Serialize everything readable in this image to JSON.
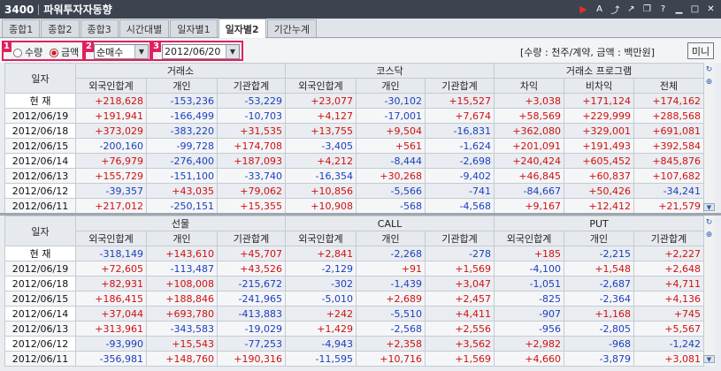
{
  "window": {
    "code": "3400",
    "title": "파워투자자동향"
  },
  "tabs": [
    "종합1",
    "종합2",
    "종합3",
    "시간대별",
    "일자별1",
    "일자별2",
    "기간누계"
  ],
  "active_tab": 5,
  "controls": {
    "markers": [
      "1",
      "2",
      "3"
    ],
    "radio_qty": "수량",
    "radio_amt": "금액",
    "type_select": "순매수",
    "date_value": "2012/06/20",
    "unit_note": "[수량 : 천주/계약, 금액 : 백만원]",
    "mini_button": "미니"
  },
  "top_table": {
    "date_header": "일자",
    "groups": [
      "거래소",
      "코스닥",
      "거래소 프로그램"
    ],
    "columns": [
      "외국인합계",
      "개인",
      "기관합계",
      "외국인합계",
      "개인",
      "기관합계",
      "차익",
      "비차익",
      "전체"
    ],
    "rows": [
      {
        "date": "현 재",
        "v": [
          "+218,628",
          "-153,236",
          "-53,229",
          "+23,077",
          "-30,102",
          "+15,527",
          "+3,038",
          "+171,124",
          "+174,162"
        ]
      },
      {
        "date": "2012/06/19",
        "v": [
          "+191,941",
          "-166,499",
          "-10,703",
          "+4,127",
          "-17,001",
          "+7,674",
          "+58,569",
          "+229,999",
          "+288,568"
        ]
      },
      {
        "date": "2012/06/18",
        "v": [
          "+373,029",
          "-383,220",
          "+31,535",
          "+13,755",
          "+9,504",
          "-16,831",
          "+362,080",
          "+329,001",
          "+691,081"
        ]
      },
      {
        "date": "2012/06/15",
        "v": [
          "-200,160",
          "-99,728",
          "+174,708",
          "-3,405",
          "+561",
          "-1,624",
          "+201,091",
          "+191,493",
          "+392,584"
        ]
      },
      {
        "date": "2012/06/14",
        "v": [
          "+76,979",
          "-276,400",
          "+187,093",
          "+4,212",
          "-8,444",
          "-2,698",
          "+240,424",
          "+605,452",
          "+845,876"
        ]
      },
      {
        "date": "2012/06/13",
        "v": [
          "+155,729",
          "-151,100",
          "-33,740",
          "-16,354",
          "+30,268",
          "-9,402",
          "+46,845",
          "+60,837",
          "+107,682"
        ]
      },
      {
        "date": "2012/06/12",
        "v": [
          "-39,357",
          "+43,035",
          "+79,062",
          "+10,856",
          "-5,566",
          "-741",
          "-84,667",
          "+50,426",
          "-34,241"
        ]
      },
      {
        "date": "2012/06/11",
        "v": [
          "+217,012",
          "-250,151",
          "+15,355",
          "+10,908",
          "-568",
          "-4,568",
          "+9,167",
          "+12,412",
          "+21,579"
        ]
      }
    ]
  },
  "bottom_table": {
    "date_header": "일자",
    "groups": [
      "선물",
      "CALL",
      "PUT"
    ],
    "columns": [
      "외국인합계",
      "개인",
      "기관합계",
      "외국인합계",
      "개인",
      "기관합계",
      "외국인합계",
      "개인",
      "기관합계"
    ],
    "rows": [
      {
        "date": "현 재",
        "v": [
          "-318,149",
          "+143,610",
          "+45,707",
          "+2,841",
          "-2,268",
          "-278",
          "+185",
          "-2,215",
          "+2,227"
        ]
      },
      {
        "date": "2012/06/19",
        "v": [
          "+72,605",
          "-113,487",
          "+43,526",
          "-2,129",
          "+91",
          "+1,569",
          "-4,100",
          "+1,548",
          "+2,648"
        ]
      },
      {
        "date": "2012/06/18",
        "v": [
          "+82,931",
          "+108,008",
          "-215,672",
          "-302",
          "-1,439",
          "+3,047",
          "-1,051",
          "-2,687",
          "+4,711"
        ]
      },
      {
        "date": "2012/06/15",
        "v": [
          "+186,415",
          "+188,846",
          "-241,965",
          "-5,010",
          "+2,689",
          "+2,457",
          "-825",
          "-2,364",
          "+4,136"
        ]
      },
      {
        "date": "2012/06/14",
        "v": [
          "+37,044",
          "+693,780",
          "-413,883",
          "+242",
          "-5,510",
          "+4,411",
          "-907",
          "+1,168",
          "+745"
        ]
      },
      {
        "date": "2012/06/13",
        "v": [
          "+313,961",
          "-343,583",
          "-19,029",
          "+1,429",
          "-2,568",
          "+2,556",
          "-956",
          "-2,805",
          "+5,567"
        ]
      },
      {
        "date": "2012/06/12",
        "v": [
          "-93,990",
          "+15,543",
          "-77,253",
          "-4,943",
          "+2,358",
          "+3,562",
          "+2,982",
          "-968",
          "-1,242"
        ]
      },
      {
        "date": "2012/06/11",
        "v": [
          "-356,981",
          "+148,760",
          "+190,316",
          "-11,595",
          "+10,716",
          "+1,569",
          "+4,660",
          "-3,879",
          "+3,081"
        ]
      }
    ]
  },
  "colors": {
    "positive": "#d01010",
    "negative": "#1a3fbf",
    "marker": "#e0205c"
  },
  "icons": [
    "play-icon",
    "font-icon",
    "export-icon",
    "link-icon",
    "window-icon",
    "help-icon",
    "minimize-icon",
    "maximize-icon",
    "close-icon",
    "refresh-icon",
    "add-icon",
    "scroll-down-icon"
  ]
}
